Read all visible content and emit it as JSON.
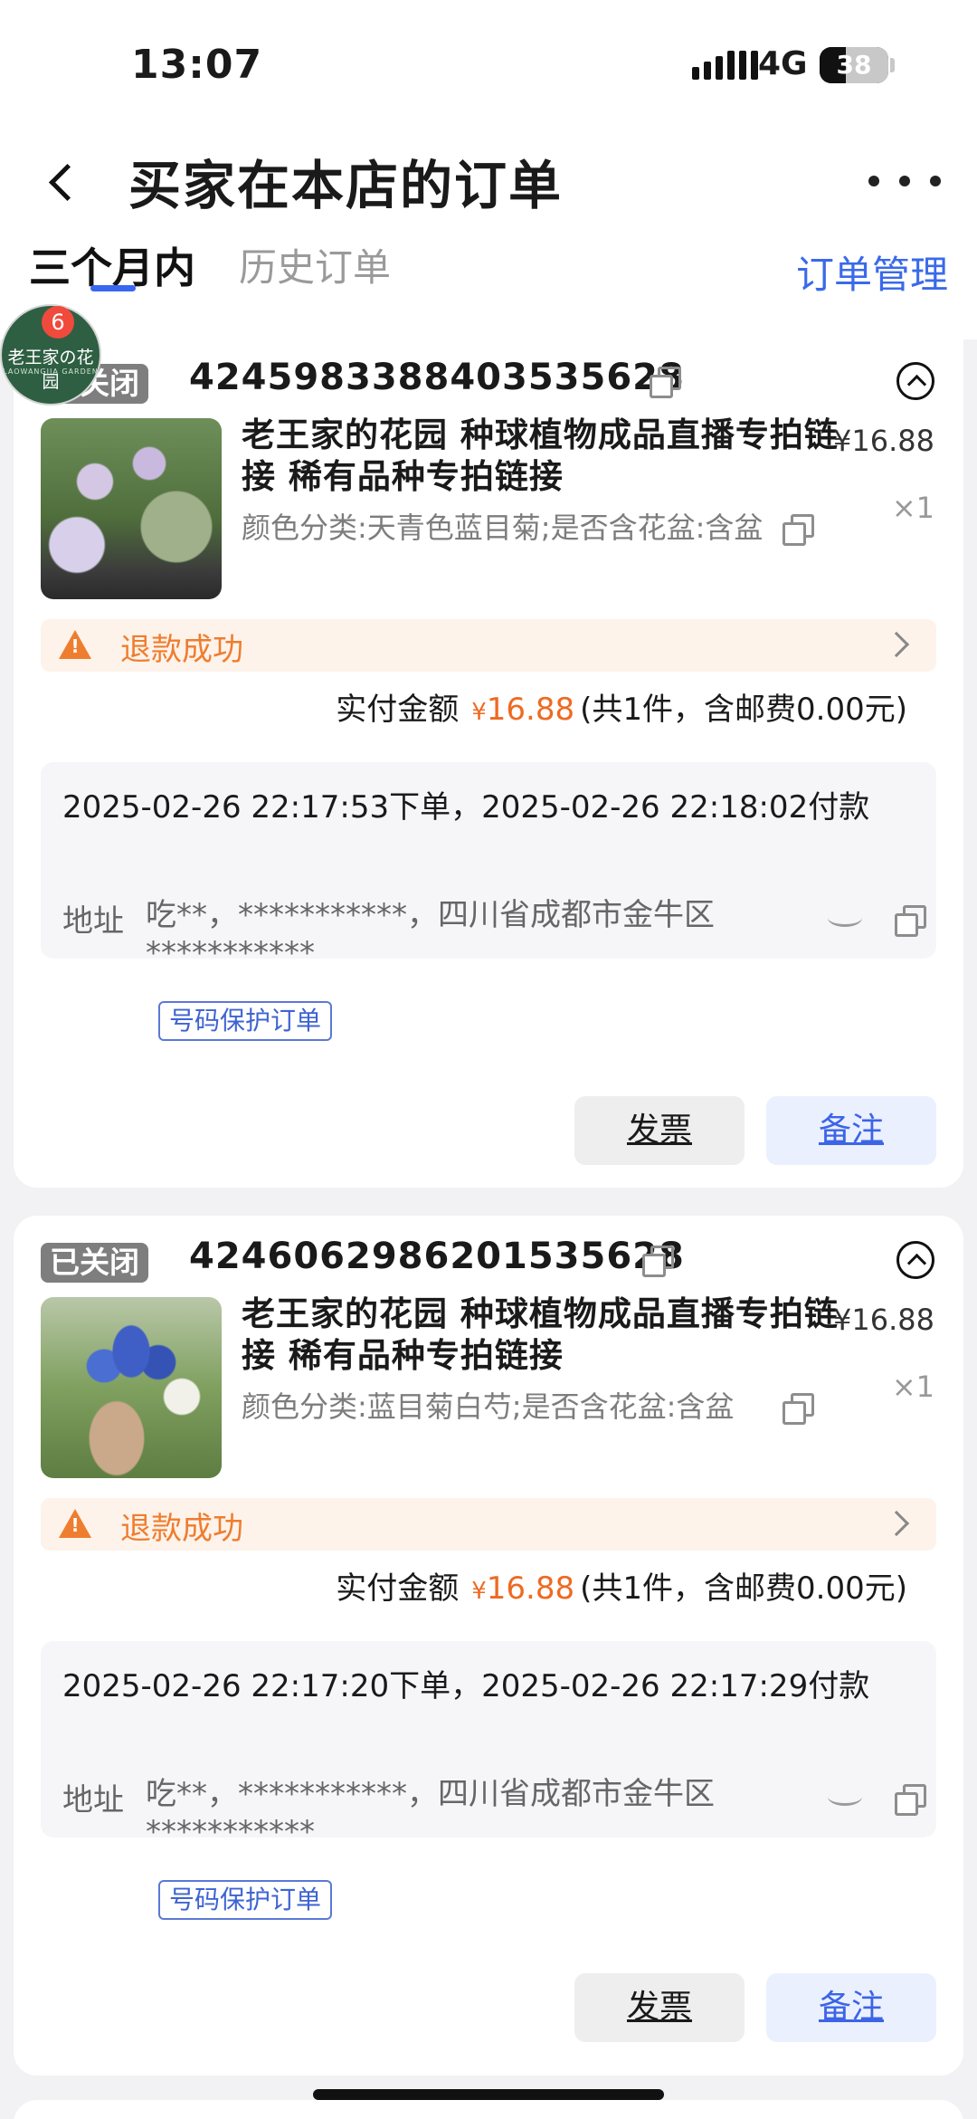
{
  "status_bar": {
    "time": "13:07",
    "network": "4G",
    "battery": "38"
  },
  "nav": {
    "title": "买家在本店的订单"
  },
  "tabs": {
    "active": "三个月内",
    "history": "历史订单",
    "manage": "订单管理"
  },
  "shop_badge": {
    "logo_text": "老王家の花园",
    "logo_sub": "LAOWANGJIA GARDEN",
    "count": "6"
  },
  "orders": [
    {
      "status_tag": "已关闭",
      "order_no": "4245983388403535628",
      "product_title": "老王家的花园 种球植物成品直播专拍链接 稀有品种专拍链接",
      "price": "¥16.88",
      "spec": "颜色分类:天青色蓝目菊;是否含花盆:含盆",
      "qty": "×1",
      "refund_text": "退款成功",
      "pay_label": "实付金额",
      "pay_yen": "¥",
      "pay_amount": "16.88",
      "pay_detail": "(共1件，含邮费0.00元)",
      "time_text": "2025-02-26 22:17:53下单，2025-02-26 22:18:02付款",
      "addr_label": "地址",
      "addr_text": "吃**，***********，四川省成都市金牛区***********",
      "protect_tag": "号码保护订单",
      "btn_invoice": "发票",
      "btn_note": "备注"
    },
    {
      "status_tag": "已关闭",
      "order_no": "4246062986201535628",
      "product_title": "老王家的花园 种球植物成品直播专拍链接 稀有品种专拍链接",
      "price": "¥16.88",
      "spec": "颜色分类:蓝目菊白芍;是否含花盆:含盆",
      "qty": "×1",
      "refund_text": "退款成功",
      "pay_label": "实付金额",
      "pay_yen": "¥",
      "pay_amount": "16.88",
      "pay_detail": "(共1件，含邮费0.00元)",
      "time_text": "2025-02-26 22:17:20下单，2025-02-26 22:17:29付款",
      "addr_label": "地址",
      "addr_text": "吃**，***********，四川省成都市金牛区***********",
      "protect_tag": "号码保护订单",
      "btn_invoice": "发票",
      "btn_note": "备注"
    }
  ],
  "colors": {
    "accent_blue": "#3a6ae8",
    "price_orange": "#ee6a22",
    "warning_orange": "#ef7d2f",
    "tag_gray": "#7e7e7e"
  }
}
